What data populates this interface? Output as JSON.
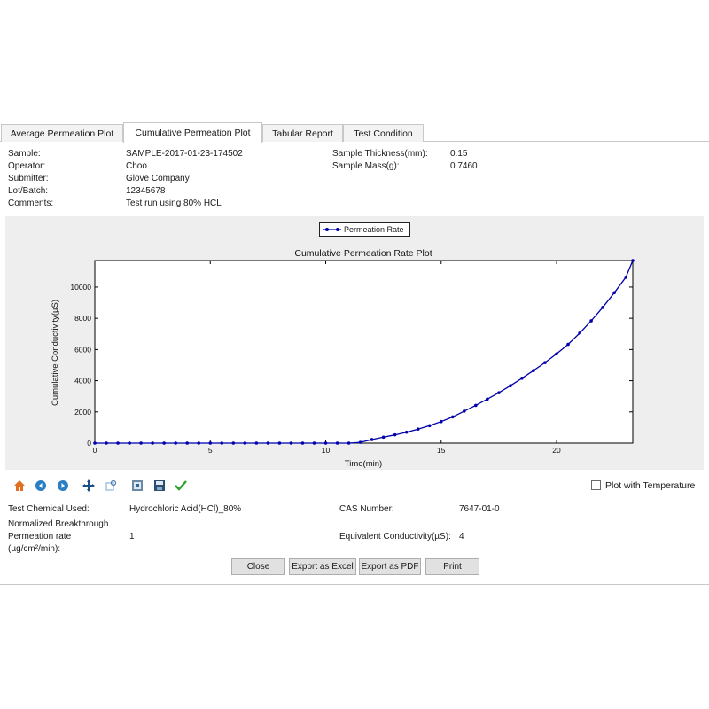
{
  "tabs": [
    {
      "label": "Average Permeation Plot"
    },
    {
      "label": "Cumulative Permeation Plot"
    },
    {
      "label": "Tabular Report"
    },
    {
      "label": "Test Condition"
    }
  ],
  "sample_info": {
    "sample_label": "Sample:",
    "sample_value": "SAMPLE-2017-01-23-174502",
    "operator_label": "Operator:",
    "operator_value": "Choo",
    "submitter_label": "Submitter:",
    "submitter_value": "Glove Company",
    "lot_label": "Lot/Batch:",
    "lot_value": "12345678",
    "comments_label": "Comments:",
    "comments_value": "Test run using 80% HCL",
    "thickness_label": "Sample Thickness(mm):",
    "thickness_value": "0.15",
    "mass_label": "Sample Mass(g):",
    "mass_value": "0.7460"
  },
  "chart_data": {
    "type": "line",
    "title": "Cumulative Permeation Rate Plot",
    "xlabel": "Time(min)",
    "ylabel": "Cumulative Conductivity(µS)",
    "xlim": [
      0,
      23.3
    ],
    "ylim": [
      0,
      11700
    ],
    "xticks": [
      "0",
      "5",
      "10",
      "15",
      "20"
    ],
    "yticks": [
      "0",
      "2000",
      "4000",
      "6000",
      "8000",
      "10000"
    ],
    "legend_position": "top-center",
    "color": "#0000aa",
    "series": [
      {
        "name": "Permeation Rate",
        "x": [
          0.0,
          0.5,
          1.0,
          1.5,
          2.0,
          2.5,
          3.0,
          3.5,
          4.0,
          4.5,
          5.0,
          5.5,
          6.0,
          6.5,
          7.0,
          7.5,
          8.0,
          8.5,
          9.0,
          9.5,
          10.0,
          10.5,
          11.0,
          11.5,
          12.0,
          12.5,
          13.0,
          13.5,
          14.0,
          14.5,
          15.0,
          15.5,
          16.0,
          16.5,
          17.0,
          17.5,
          18.0,
          18.5,
          19.0,
          19.5,
          20.0,
          20.5,
          21.0,
          21.5,
          22.0,
          22.5,
          23.0,
          23.3
        ],
        "values": [
          0,
          0,
          0,
          0,
          0,
          0,
          0,
          0,
          0,
          0,
          0,
          0,
          0,
          0,
          0,
          0,
          0,
          0,
          0,
          0,
          0,
          0,
          0,
          50,
          230,
          380,
          530,
          700,
          900,
          1120,
          1380,
          1680,
          2050,
          2420,
          2820,
          3230,
          3680,
          4160,
          4650,
          5160,
          5720,
          6330,
          7050,
          7840,
          8700,
          9640,
          10630,
          11700
        ]
      }
    ]
  },
  "toolbar": {
    "icons": [
      "home-icon",
      "back-arrow-icon",
      "forward-arrow-icon",
      "pan-icon",
      "zoom-icon",
      "configure-subplots-icon",
      "save-icon",
      "checkmark-icon"
    ]
  },
  "plot_with_temperature_label": "Plot with Temperature",
  "results": {
    "chemical_label": "Test Chemical Used:",
    "chemical_value": "Hydrochloric Acid(HCl)_80%",
    "cas_label": "CAS Number:",
    "cas_value": "7647-01-0",
    "nbt_label_1": "Normalized Breakthrough",
    "nbt_label_2": "Permeation rate",
    "nbt_label_3": "(µg/cm²/min):",
    "nbt_value": "1",
    "equiv_label": "Equivalent Conductivity(µS):",
    "equiv_value": "4"
  },
  "buttons": {
    "close": "Close",
    "export_excel": "Export as Excel",
    "export_pdf": "Export as PDF",
    "print": "Print"
  }
}
